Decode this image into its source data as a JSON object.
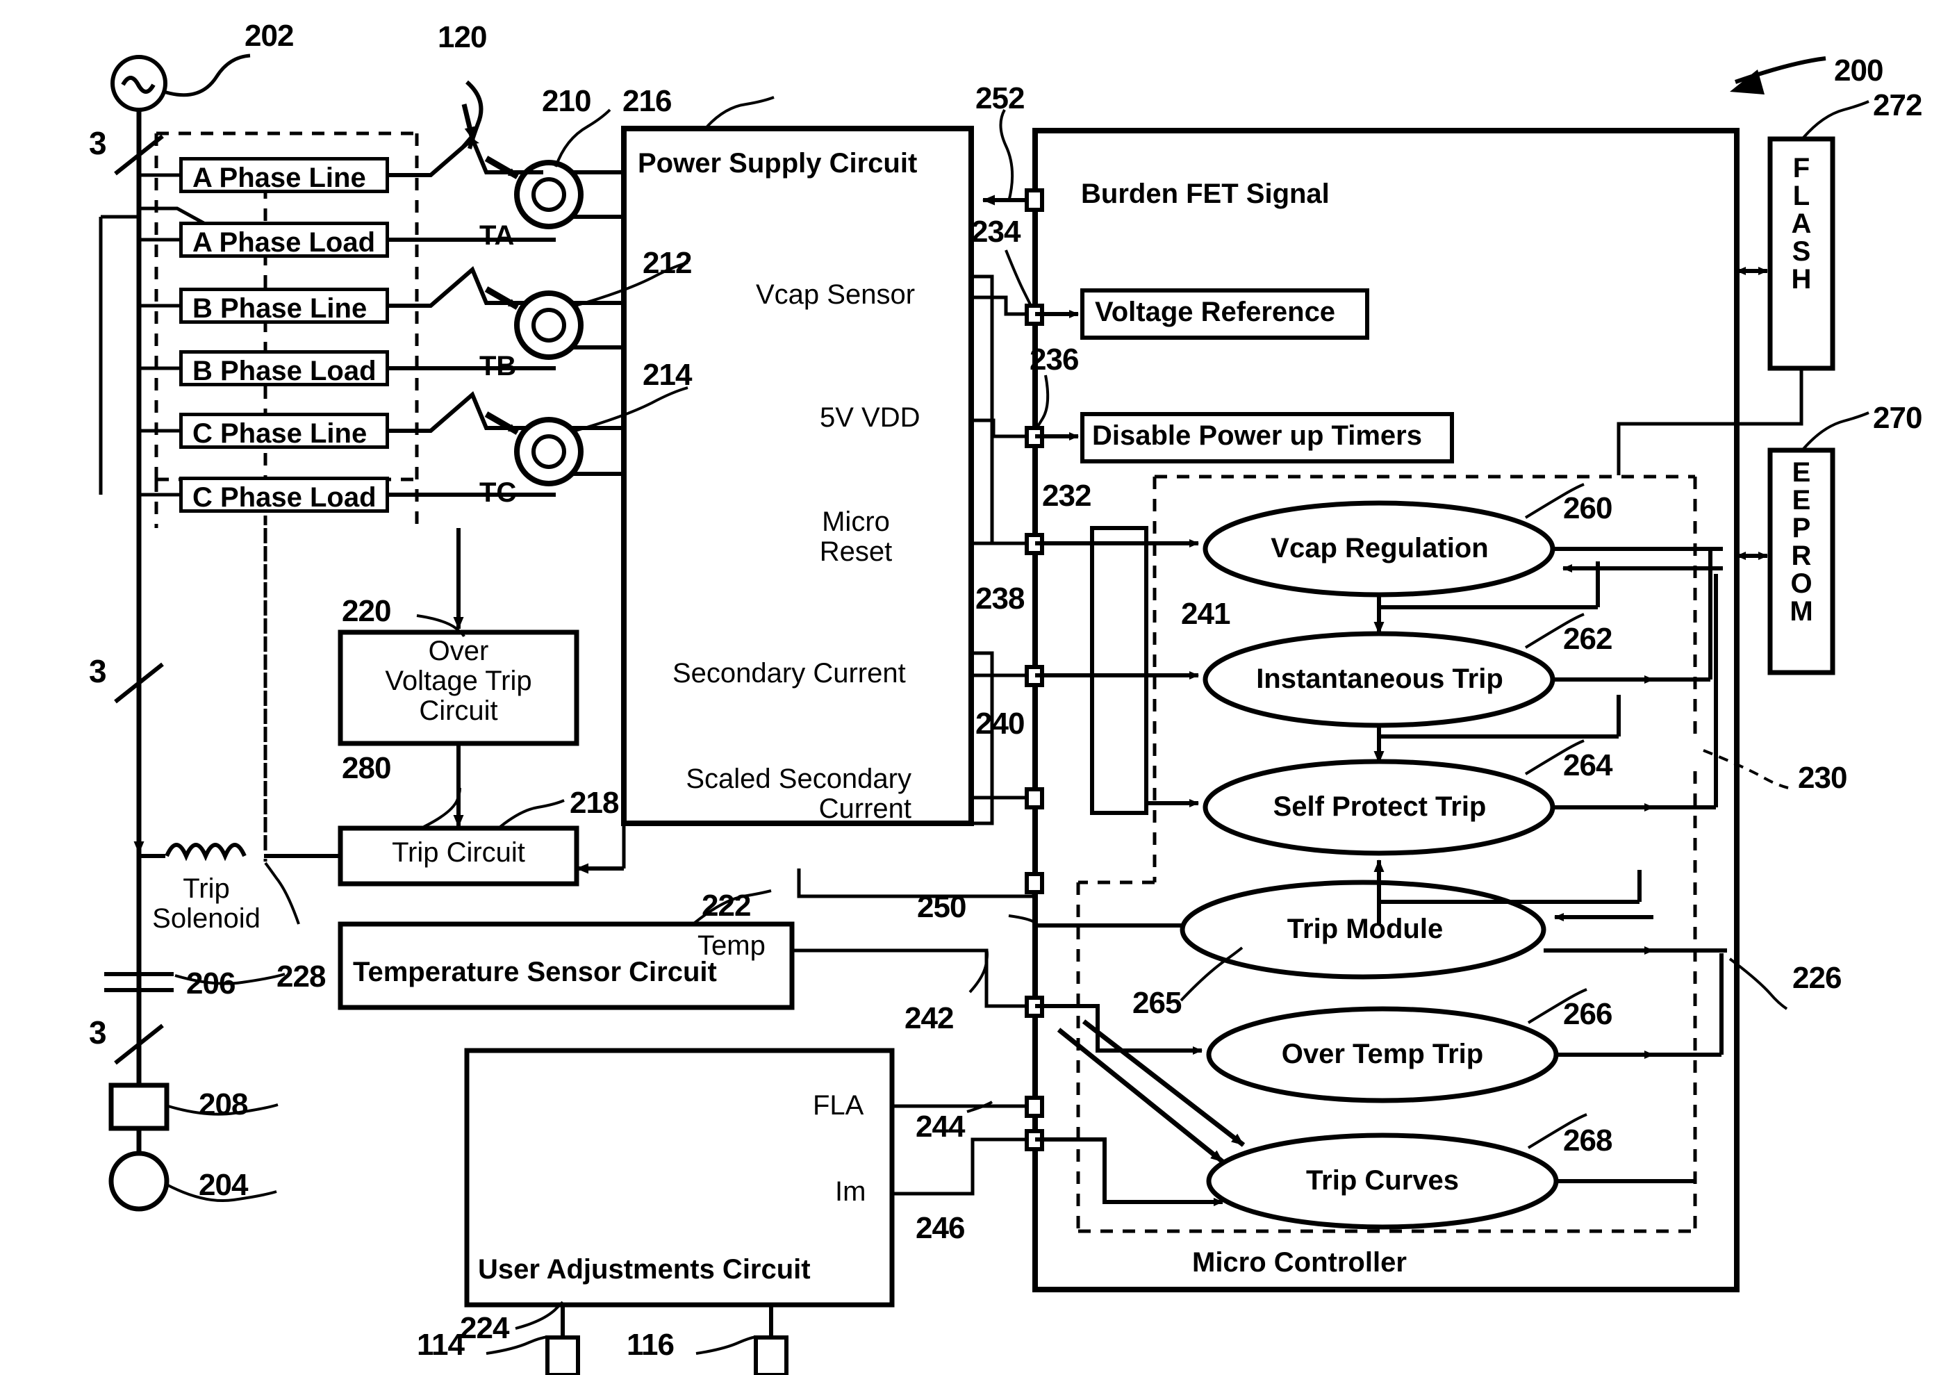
{
  "figure": {
    "label": "200",
    "breaker_group": "120"
  },
  "source": {
    "ac_source_ref": "202",
    "load_ref": "204",
    "capacitor_ref": "206",
    "resistor_ref": "208",
    "phase_count_top": "3",
    "phase_count_mid": "3",
    "phase_count_bottom": "3"
  },
  "phase_boxes": [
    {
      "line": "A Phase Line",
      "load": "A Phase Load",
      "ct": "TA",
      "ct_ref": "210"
    },
    {
      "line": "B Phase Line",
      "load": "B Phase Load",
      "ct": "TB",
      "ct_ref": "212"
    },
    {
      "line": "C Phase Line",
      "load": "C Phase Load",
      "ct": "TC",
      "ct_ref": "214"
    }
  ],
  "power_supply": {
    "title": "Power Supply Circuit",
    "ref": "216",
    "outputs": [
      {
        "name": "Vcap Sensor",
        "ref": "236"
      },
      {
        "name": "5V VDD",
        "ref": "232"
      },
      {
        "name": "Micro\nReset",
        "ref": "238"
      },
      {
        "name": "Secondary Current",
        "ref": "240"
      },
      {
        "name": "Scaled Secondary\nCurrent",
        "ref": "241"
      }
    ],
    "burden_ref": "234",
    "burden_top_ref": "252"
  },
  "over_voltage_trip": {
    "title": "Over\nVoltage Trip\nCircuit",
    "ref": "220",
    "output_ref": "280"
  },
  "trip_circuit": {
    "title": "Trip Circuit",
    "ref": "218"
  },
  "trip_solenoid": {
    "title": "Trip\nSolenoid",
    "ref": "228"
  },
  "temperature_sensor": {
    "title": "Temperature Sensor Circuit",
    "ref": "222",
    "output_label": "Temp",
    "output_ref": "242"
  },
  "user_adjustments": {
    "title": "User Adjustments Circuit",
    "ref": "224",
    "outputs": [
      {
        "label": "FLA",
        "ref": "244"
      },
      {
        "label": "Im",
        "ref": "246"
      }
    ],
    "knobs": [
      {
        "ref": "114"
      },
      {
        "ref": "116"
      }
    ]
  },
  "micro_controller": {
    "title": "Micro Controller",
    "dashed_ref": "230",
    "bus_ref": "226",
    "trip_module_in_ref": "250",
    "signals": [
      {
        "label": "Burden FET Signal"
      },
      {
        "label": "Voltage Reference"
      },
      {
        "label": "Disable Power up Timers",
        "ref": "236"
      }
    ],
    "blocks": [
      {
        "label": "Vcap Regulation",
        "ref": "260"
      },
      {
        "label": "Instantaneous Trip",
        "ref": "262"
      },
      {
        "label": "Self Protect Trip",
        "ref": "264"
      },
      {
        "label": "Trip Module",
        "ref": "265"
      },
      {
        "label": "Over Temp Trip",
        "ref": "266"
      },
      {
        "label": "Trip Curves",
        "ref": "268"
      }
    ]
  },
  "memory": [
    {
      "label": "F\nL\nA\nS\nH",
      "ref": "272"
    },
    {
      "label": "E\nE\nP\nR\nO\nM",
      "ref": "270"
    }
  ],
  "colors": {
    "ink": "#000000",
    "paper": "#ffffff"
  }
}
